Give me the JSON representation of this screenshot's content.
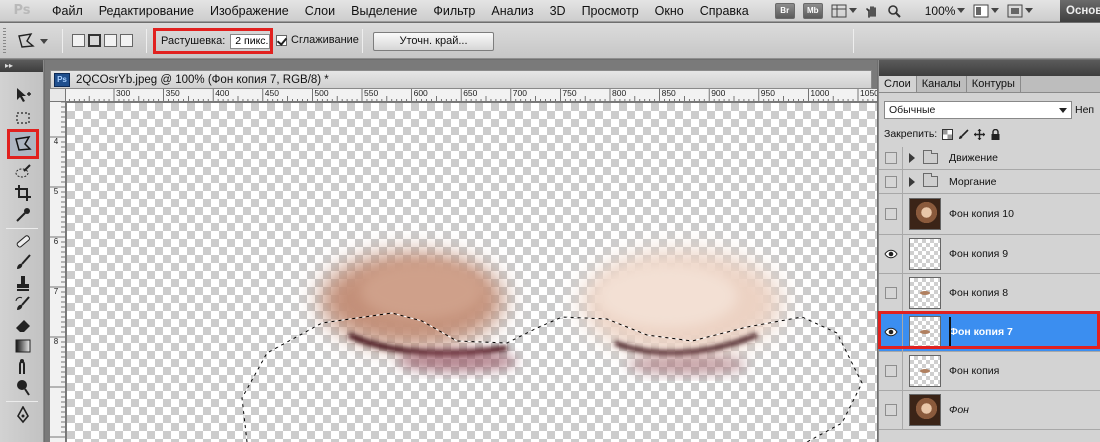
{
  "app": {
    "logo": "Ps",
    "workspace": "Основ"
  },
  "menu": [
    "Файл",
    "Редактирование",
    "Изображение",
    "Слои",
    "Выделение",
    "Фильтр",
    "Анализ",
    "3D",
    "Просмотр",
    "Окно",
    "Справка"
  ],
  "bridge": {
    "br": "Br",
    "mb": "Mb"
  },
  "zoom": "100%",
  "options": {
    "feather_label": "Растушевка:",
    "feather_value": "2 пикс.",
    "antialias_label": "Сглаживание",
    "antialias_checked": true,
    "refine_edge": "Уточн. край..."
  },
  "document": {
    "badge": "Ps",
    "title": "2QCOsrYb.jpeg @ 100% (Фон копия 7, RGB/8) *",
    "ruler_top": [
      "300",
      "350",
      "400",
      "450",
      "500",
      "550",
      "600",
      "650",
      "700",
      "750",
      "800",
      "850",
      "900",
      "950",
      "1000",
      "1050"
    ],
    "ruler_left": [
      "4",
      "5",
      "6",
      "7",
      "8"
    ]
  },
  "layers_panel": {
    "tabs": [
      "Слои",
      "Каналы",
      "Контуры"
    ],
    "active_tab": "Слои",
    "blend_mode": "Обычные",
    "opacity_label": "Неп",
    "lock_label": "Закрепить:",
    "layers": [
      {
        "name": "Движение",
        "kind": "group",
        "visible": false
      },
      {
        "name": "Моргание",
        "kind": "group",
        "visible": false
      },
      {
        "name": "Фон копия 10",
        "kind": "photo",
        "visible": false
      },
      {
        "name": "Фон копия 9",
        "kind": "transparent",
        "visible": true
      },
      {
        "name": "Фон копия 8",
        "kind": "transparent",
        "visible": false
      },
      {
        "name": "Фон копия 7",
        "kind": "transparent",
        "visible": true,
        "selected": true
      },
      {
        "name": "Фон копия",
        "kind": "transparent",
        "visible": false
      },
      {
        "name": "Фон",
        "kind": "photo",
        "visible": false,
        "italic": true
      }
    ]
  },
  "colors": {
    "highlight": "#e1211f",
    "selection": "#3b8ef0"
  }
}
